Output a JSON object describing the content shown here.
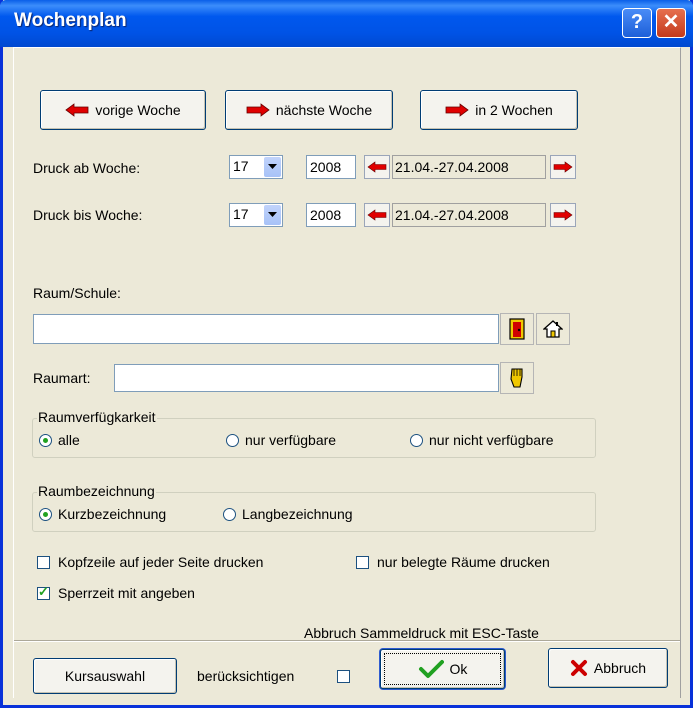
{
  "window": {
    "title": "Wochenplan",
    "help_glyph": "?",
    "close_glyph": "✕"
  },
  "nav_buttons": {
    "prev_week": "vorige Woche",
    "next_week": "nächste Woche",
    "in_two_weeks": "in 2 Wochen"
  },
  "print_from": {
    "label": "Druck ab Woche:",
    "week": "17",
    "year": "2008",
    "range": "21.04.-27.04.2008"
  },
  "print_to": {
    "label": "Druck bis Woche:",
    "week": "17",
    "year": "2008",
    "range": "21.04.-27.04.2008"
  },
  "room": {
    "label": "Raum/Schule:",
    "value": ""
  },
  "room_type": {
    "label": "Raumart:",
    "value": ""
  },
  "availability": {
    "title": "Raumverfügkarkeit",
    "options": [
      "alle",
      "nur verfügbare",
      "nur nicht verfügbare"
    ],
    "selected": "alle"
  },
  "naming": {
    "title": "Raumbezeichnung",
    "options": [
      "Kurzbezeichnung",
      "Langbezeichnung"
    ],
    "selected": "Kurzbezeichnung"
  },
  "checks": {
    "header_each_page": {
      "label": "Kopfzeile auf jeder Seite drucken",
      "checked": false
    },
    "occupied_only": {
      "label": "nur belegte Räume drucken",
      "checked": false
    },
    "lock_time": {
      "label": "Sperrzeit mit angeben",
      "checked": true
    }
  },
  "hint": "Abbruch Sammeldruck mit ESC-Taste",
  "footer": {
    "course_select": "Kursauswahl",
    "consider_label": "berücksichtigen",
    "consider_checked": false,
    "ok": "Ok",
    "cancel": "Abbruch"
  },
  "colors": {
    "arrow_red": "#e00000",
    "title_blue": "#0058ee",
    "face": "#ece9d8",
    "check_green": "#21a121"
  }
}
